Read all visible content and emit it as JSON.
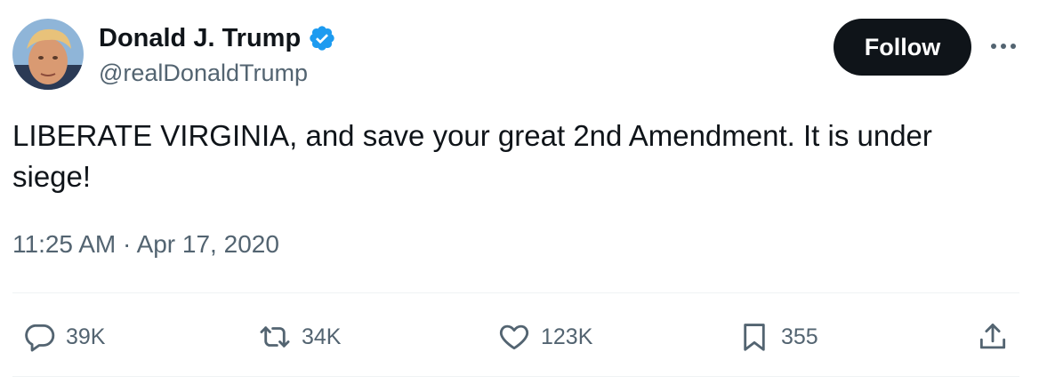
{
  "author": {
    "name": "Donald J. Trump",
    "handle": "@realDonaldTrump",
    "verified": true,
    "verified_color": "#1d9bf0"
  },
  "follow_button": {
    "label": "Follow"
  },
  "more_menu": {
    "icon": "more-horizontal-icon"
  },
  "tweet": {
    "text": "LIBERATE VIRGINIA, and save your great 2nd Amendment. It is under siege!",
    "timestamp": "11:25 AM · Apr 17, 2020"
  },
  "actions": {
    "replies": {
      "icon": "reply-icon",
      "count": "39K"
    },
    "retweets": {
      "icon": "retweet-icon",
      "count": "34K"
    },
    "likes": {
      "icon": "heart-icon",
      "count": "123K"
    },
    "bookmarks": {
      "icon": "bookmark-icon",
      "count": "355"
    },
    "share": {
      "icon": "share-icon"
    }
  },
  "colors": {
    "text_primary": "#0f1419",
    "text_secondary": "#536471",
    "divider": "#eff3f4",
    "follow_bg": "#0f1419"
  }
}
